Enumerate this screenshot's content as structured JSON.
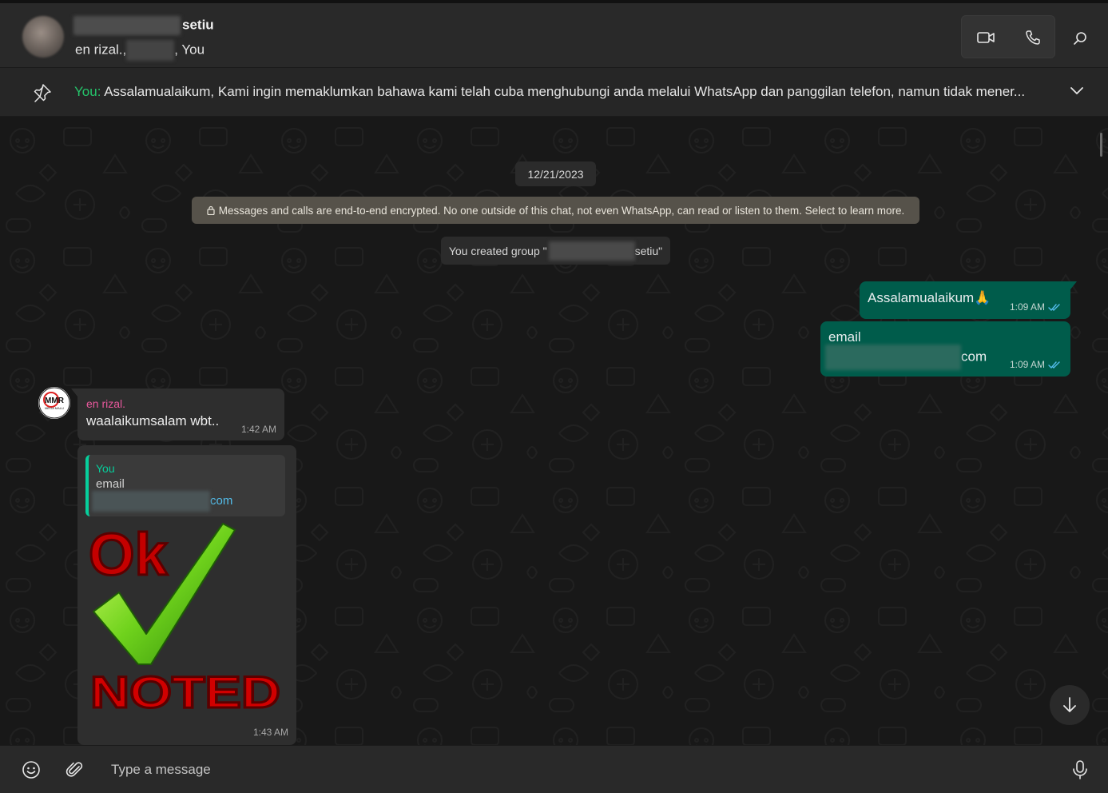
{
  "header": {
    "title_suffix": "setiu",
    "subtitle_part1": "en rizal.,",
    "subtitle_part2": ", You"
  },
  "pinned": {
    "prefix": "You:",
    "text": " Assalamualaikum,  Kami ingin memaklumkan bahawa kami telah cuba menghubungi anda melalui WhatsApp dan panggilan telefon, namun tidak mener..."
  },
  "chat": {
    "date": "12/21/2023",
    "encryption_notice": "Messages and calls are end-to-end encrypted. No one outside of this chat, not even WhatsApp, can read or listen to them. Select to learn more.",
    "group_created_prefix": "You created group \"",
    "group_created_suffix": "setiu\"",
    "outgoing": [
      {
        "text": "Assalamualaikum",
        "emoji": "🙏",
        "time": "1:09 AM"
      },
      {
        "text": "email",
        "line2_suffix": "com",
        "time": "1:09 AM"
      }
    ],
    "incoming": [
      {
        "sender": "en rizal.",
        "text": "waalaikumsalam wbt..",
        "time": "1:42 AM"
      },
      {
        "quote_name": "You",
        "quote_text": "email",
        "quote_line2_suffix": "com",
        "image_top_text": "Ok",
        "image_bottom_text": "NOTED",
        "time": "1:43 AM"
      }
    ],
    "avatar_text": "MMR",
    "avatar_subtext": "MEGA MALU"
  },
  "composer": {
    "placeholder": "Type a message"
  },
  "colors": {
    "accent": "#25c36a",
    "outgoing_bubble": "#005c4b",
    "incoming_bubble": "#2e2e2e",
    "sender_name": "#e8589c",
    "read_ticks": "#53bdeb"
  }
}
